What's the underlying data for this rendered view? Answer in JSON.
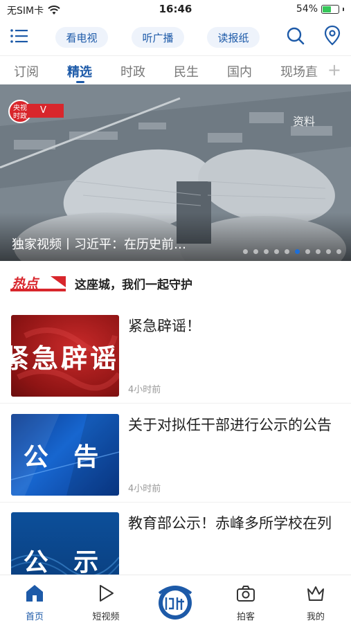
{
  "status": {
    "carrier": "无SIM卡",
    "time": "16:46",
    "battery": "54%"
  },
  "topbar": {
    "tv": "看电视",
    "radio": "听广播",
    "paper": "读报纸"
  },
  "tabs": [
    "订阅",
    "精选",
    "时政",
    "民生",
    "国内",
    "现场直"
  ],
  "tab_add": "+",
  "banner": {
    "badge_top": "央视",
    "badge_bottom": "时政",
    "ribbon": "V",
    "tag": "资料",
    "title": "独家视频丨习近平：在历史前…",
    "slides": 10,
    "active_slide": 5
  },
  "hot": {
    "logo": "热点",
    "text": "这座城，我们一起守护"
  },
  "news": [
    {
      "title": "紧急辟谣！",
      "time": "4小时前",
      "thumb_text": "紧急辟谣"
    },
    {
      "title": "关于对拟任干部进行公示的公告",
      "time": "4小时前",
      "thumb_text": "公 告"
    },
    {
      "title": "教育部公示！赤峰多所学校在列",
      "time": "",
      "thumb_text": "公 示"
    }
  ],
  "nav": {
    "home": "首页",
    "short_video": "短视频",
    "paike": "拍客",
    "mine": "我的"
  },
  "colors": {
    "accent": "#1d5aa8",
    "red": "#d8262c"
  }
}
